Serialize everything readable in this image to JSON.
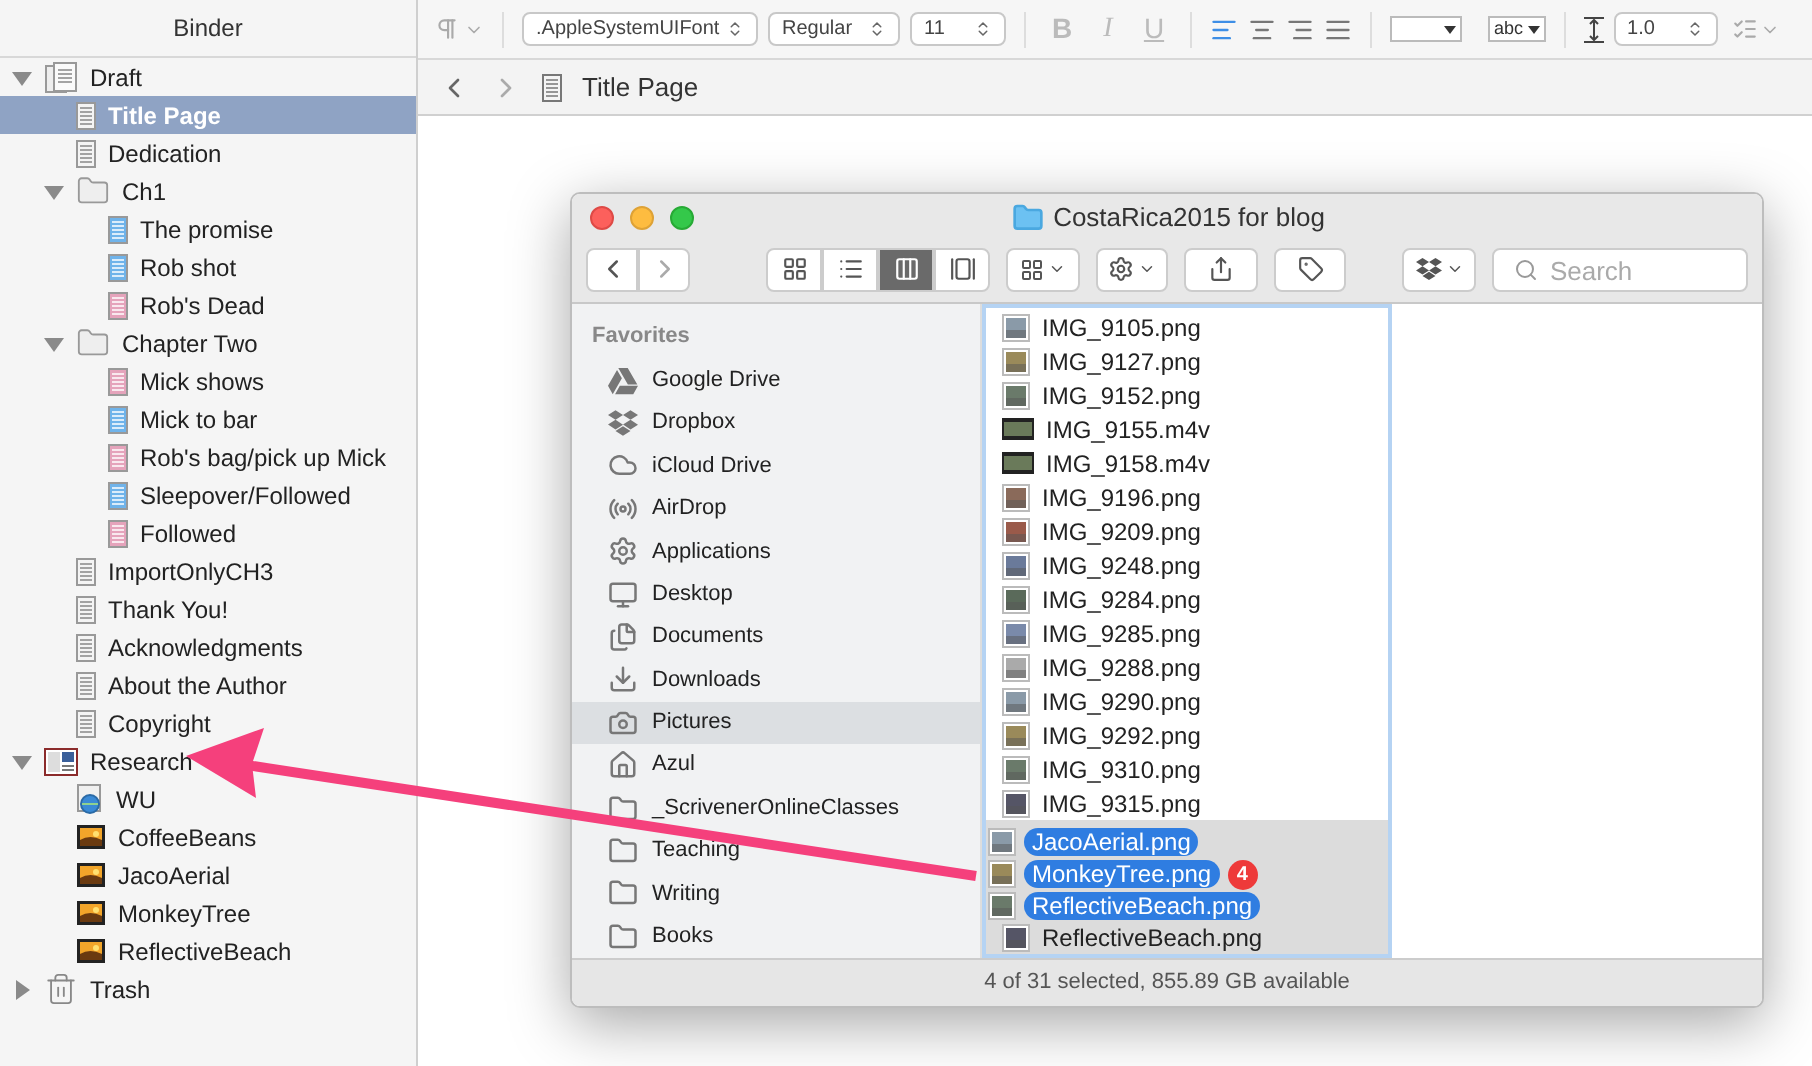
{
  "binder": {
    "title": "Binder",
    "items": [
      {
        "label": "Draft",
        "kind": "draft",
        "expanded": true,
        "selected": false,
        "children": [
          {
            "label": "Title Page",
            "kind": "doc",
            "selected": true
          },
          {
            "label": "Dedication",
            "kind": "doc",
            "selected": false
          },
          {
            "label": "Ch1",
            "kind": "folder",
            "expanded": true,
            "selected": false,
            "children": [
              {
                "label": "The promise",
                "kind": "doc-blue",
                "selected": false
              },
              {
                "label": "Rob shot",
                "kind": "doc-blue",
                "selected": false
              },
              {
                "label": "Rob's Dead",
                "kind": "doc-pink",
                "selected": false
              }
            ]
          },
          {
            "label": "Chapter Two",
            "kind": "folder",
            "expanded": true,
            "selected": false,
            "children": [
              {
                "label": "Mick shows",
                "kind": "doc-pink",
                "selected": false
              },
              {
                "label": "Mick to bar",
                "kind": "doc-blue",
                "selected": false
              },
              {
                "label": "Rob's bag/pick up Mick",
                "kind": "doc-pink",
                "selected": false
              },
              {
                "label": "Sleepover/Followed",
                "kind": "doc-blue",
                "selected": false
              },
              {
                "label": "Followed",
                "kind": "doc-pink",
                "selected": false
              }
            ]
          },
          {
            "label": "ImportOnlyCH3",
            "kind": "doc",
            "selected": false
          },
          {
            "label": "Thank You!",
            "kind": "doc",
            "selected": false
          },
          {
            "label": "Acknowledgments",
            "kind": "doc",
            "selected": false
          },
          {
            "label": "About the Author",
            "kind": "doc",
            "selected": false
          },
          {
            "label": "Copyright",
            "kind": "doc",
            "selected": false
          }
        ]
      },
      {
        "label": "Research",
        "kind": "research",
        "expanded": true,
        "selected": false,
        "children": [
          {
            "label": "WU",
            "kind": "web",
            "selected": false
          },
          {
            "label": "CoffeeBeans",
            "kind": "image",
            "selected": false
          },
          {
            "label": "JacoAerial",
            "kind": "image",
            "selected": false
          },
          {
            "label": "MonkeyTree",
            "kind": "image",
            "selected": false
          },
          {
            "label": "ReflectiveBeach",
            "kind": "image",
            "selected": false
          }
        ]
      },
      {
        "label": "Trash",
        "kind": "trash",
        "expanded": false,
        "selected": false
      }
    ]
  },
  "format_bar": {
    "font_family": ".AppleSystemUIFont",
    "font_style": "Regular",
    "font_size": "11",
    "styles": [
      "B",
      "I",
      "U"
    ],
    "alignments": [
      {
        "kind": "left",
        "selected": true
      },
      {
        "kind": "center",
        "selected": false
      },
      {
        "kind": "right",
        "selected": false
      },
      {
        "kind": "justify",
        "selected": false
      }
    ],
    "highlight_label": "abc",
    "line_spacing": "1.0"
  },
  "editor": {
    "document_title": "Title Page"
  },
  "finder": {
    "title": "CostaRica2015 for blog",
    "view_modes": [
      {
        "kind": "icon",
        "selected": false
      },
      {
        "kind": "list",
        "selected": false
      },
      {
        "kind": "column",
        "selected": true
      },
      {
        "kind": "coverflow",
        "selected": false
      }
    ],
    "search": {
      "placeholder": "Search"
    },
    "sidebar_heading": "Favorites",
    "sidebar": [
      {
        "label": "Google Drive",
        "kind": "gdrive",
        "selected": false
      },
      {
        "label": "Dropbox",
        "kind": "dropbox",
        "selected": false
      },
      {
        "label": "iCloud Drive",
        "kind": "cloud",
        "selected": false
      },
      {
        "label": "AirDrop",
        "kind": "airdrop",
        "selected": false
      },
      {
        "label": "Applications",
        "kind": "apps",
        "selected": false
      },
      {
        "label": "Desktop",
        "kind": "desktop",
        "selected": false
      },
      {
        "label": "Documents",
        "kind": "documents",
        "selected": false
      },
      {
        "label": "Downloads",
        "kind": "downloads",
        "selected": false
      },
      {
        "label": "Pictures",
        "kind": "pictures",
        "selected": true
      },
      {
        "label": "Azul",
        "kind": "home",
        "selected": false
      },
      {
        "label": "_ScrivenerOnlineClasses",
        "kind": "folder",
        "selected": false
      },
      {
        "label": "Teaching",
        "kind": "folder",
        "selected": false
      },
      {
        "label": "Writing",
        "kind": "folder",
        "selected": false
      },
      {
        "label": "Books",
        "kind": "folder",
        "selected": false
      }
    ],
    "files": [
      {
        "name": "IMG_9105.png",
        "kind": "image",
        "selected": false
      },
      {
        "name": "IMG_9127.png",
        "kind": "image",
        "selected": false
      },
      {
        "name": "IMG_9152.png",
        "kind": "image",
        "selected": false
      },
      {
        "name": "IMG_9155.m4v",
        "kind": "video",
        "selected": false
      },
      {
        "name": "IMG_9158.m4v",
        "kind": "video",
        "selected": false
      },
      {
        "name": "IMG_9196.png",
        "kind": "image",
        "selected": false
      },
      {
        "name": "IMG_9209.png",
        "kind": "image",
        "selected": false
      },
      {
        "name": "IMG_9248.png",
        "kind": "image",
        "selected": false
      },
      {
        "name": "IMG_9284.png",
        "kind": "image",
        "selected": false
      },
      {
        "name": "IMG_9285.png",
        "kind": "image",
        "selected": false
      },
      {
        "name": "IMG_9288.png",
        "kind": "image",
        "selected": false
      },
      {
        "name": "IMG_9290.png",
        "kind": "image",
        "selected": false
      },
      {
        "name": "IMG_9292.png",
        "kind": "image",
        "selected": false
      },
      {
        "name": "IMG_9310.png",
        "kind": "image",
        "selected": false
      },
      {
        "name": "IMG_9315.png",
        "kind": "image",
        "selected": false
      }
    ],
    "selected_files": [
      {
        "name": "ReflectiveBeach.png",
        "kind": "image",
        "selected": true
      }
    ],
    "drag": {
      "items": [
        "JacoAerial.png",
        "MonkeyTree.png",
        "ReflectiveBeach.png"
      ],
      "count": "4"
    },
    "status": "4 of 31 selected, 855.89 GB available"
  }
}
